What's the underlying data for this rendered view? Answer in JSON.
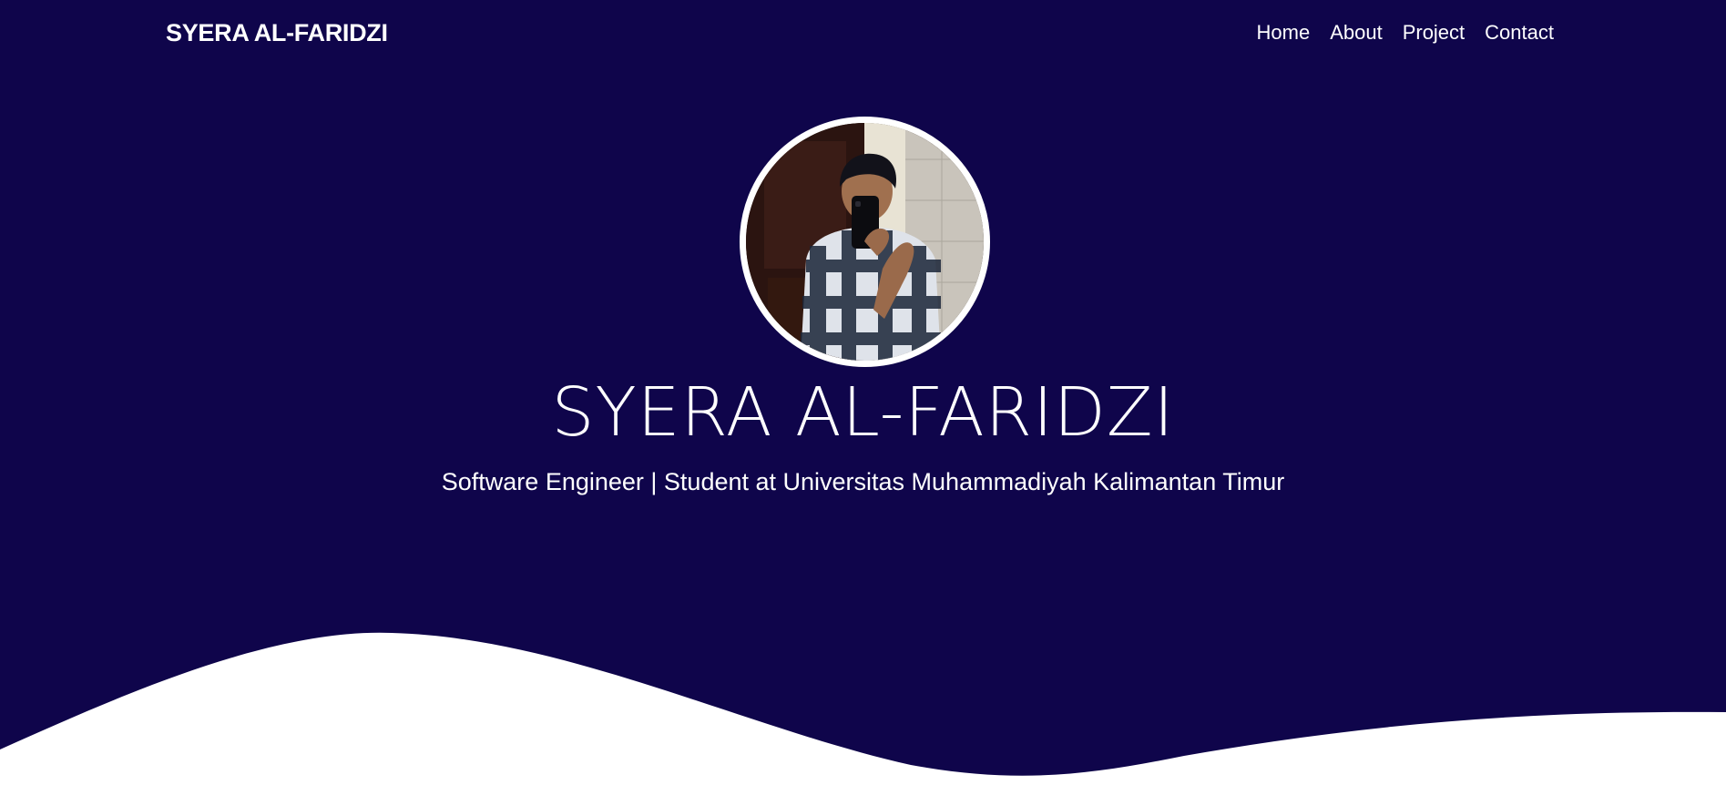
{
  "navbar": {
    "brand": "SYERA AL-FARIDZI",
    "links": [
      "Home",
      "About",
      "Project",
      "Contact"
    ]
  },
  "hero": {
    "title": "SYERA AL-FARIDZI",
    "subtitle": "Software Engineer | Student at Universitas Muhammadiyah Kalimantan Timur"
  },
  "colors": {
    "background": "#0f054b",
    "text": "#ffffff",
    "wave": "#ffffff"
  }
}
